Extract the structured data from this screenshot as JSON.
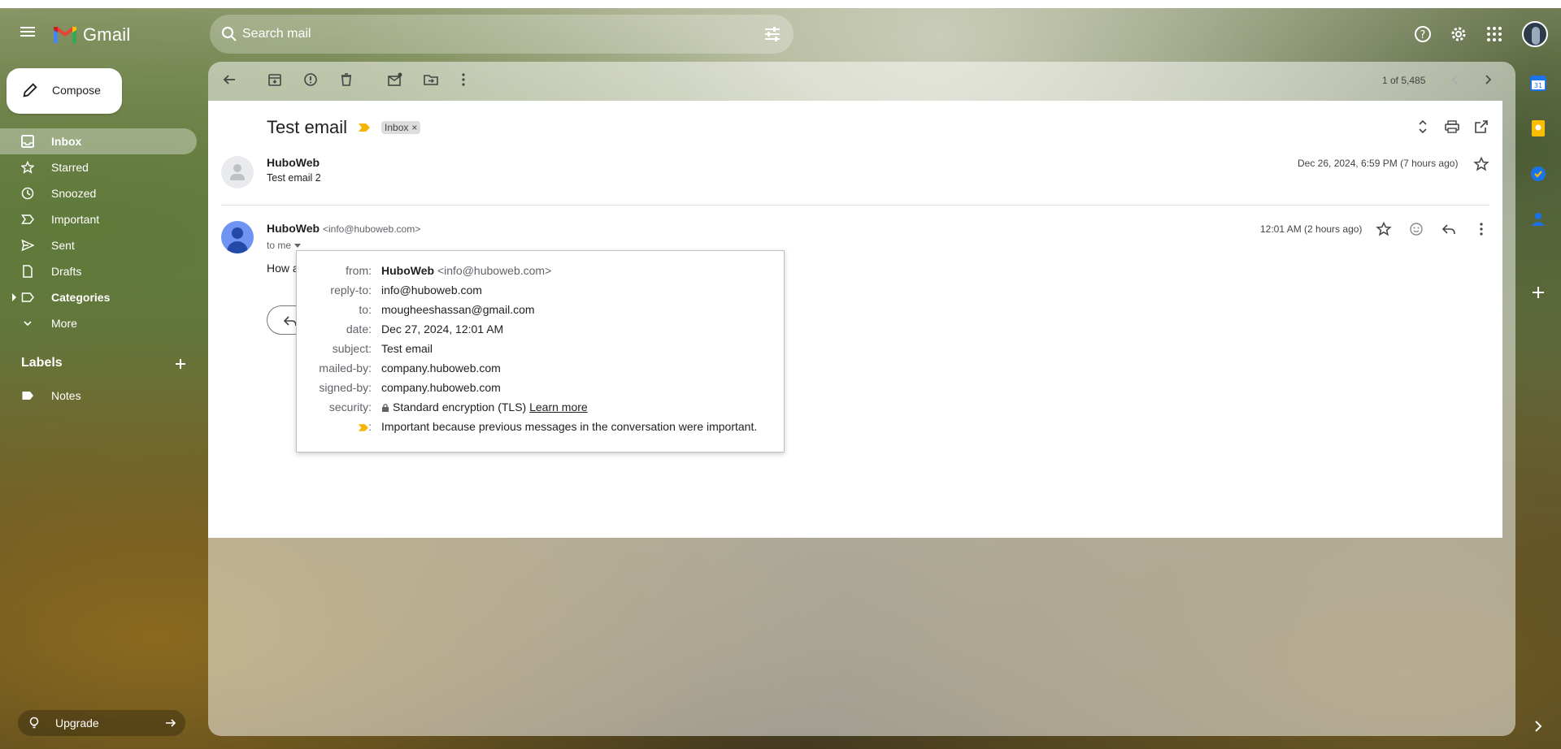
{
  "app": {
    "name": "Gmail"
  },
  "search": {
    "placeholder": "Search mail"
  },
  "compose": {
    "label": "Compose"
  },
  "nav": {
    "items": [
      {
        "label": "Inbox",
        "icon": "inbox-icon"
      },
      {
        "label": "Starred",
        "icon": "star-icon"
      },
      {
        "label": "Snoozed",
        "icon": "clock-icon"
      },
      {
        "label": "Important",
        "icon": "label-important-icon"
      },
      {
        "label": "Sent",
        "icon": "send-icon"
      },
      {
        "label": "Drafts",
        "icon": "draft-icon"
      },
      {
        "label": "Categories",
        "icon": "label-icon"
      },
      {
        "label": "More",
        "icon": "chevron-down-icon"
      }
    ],
    "labels_header": "Labels",
    "labels": [
      {
        "label": "Notes"
      }
    ],
    "upgrade": "Upgrade"
  },
  "toolbar": {
    "pager": "1 of 5,485"
  },
  "thread": {
    "subject": "Test email",
    "chip": "Inbox",
    "chip_close": "×",
    "messages": [
      {
        "sender": "HuboWeb",
        "snippet": "Test email 2",
        "date": "Dec 26, 2024, 6:59 PM (7 hours ago)"
      },
      {
        "sender": "HuboWeb",
        "email": "<info@huboweb.com>",
        "to": "to me",
        "date": "12:01 AM (2 hours ago)",
        "body": "How a"
      }
    ]
  },
  "details": {
    "from_label": "from:",
    "from_name": "HuboWeb",
    "from_email": "<info@huboweb.com>",
    "reply_to_label": "reply-to:",
    "reply_to": "info@huboweb.com",
    "to_label": "to:",
    "to": "mougheeshassan@gmail.com",
    "date_label": "date:",
    "date": "Dec 27, 2024, 12:01 AM",
    "subject_label": "subject:",
    "subject": "Test email",
    "mailed_by_label": "mailed-by:",
    "mailed_by": "company.huboweb.com",
    "signed_by_label": "signed-by:",
    "signed_by": "company.huboweb.com",
    "security_label": "security:",
    "security": "Standard encryption (TLS)",
    "learn_more": "Learn more",
    "importance_label": ":",
    "importance": "Important because previous messages in the conversation were important."
  },
  "colors": {
    "importance_marker": "#f4b400",
    "avatar_blue": "#6f94f2"
  }
}
